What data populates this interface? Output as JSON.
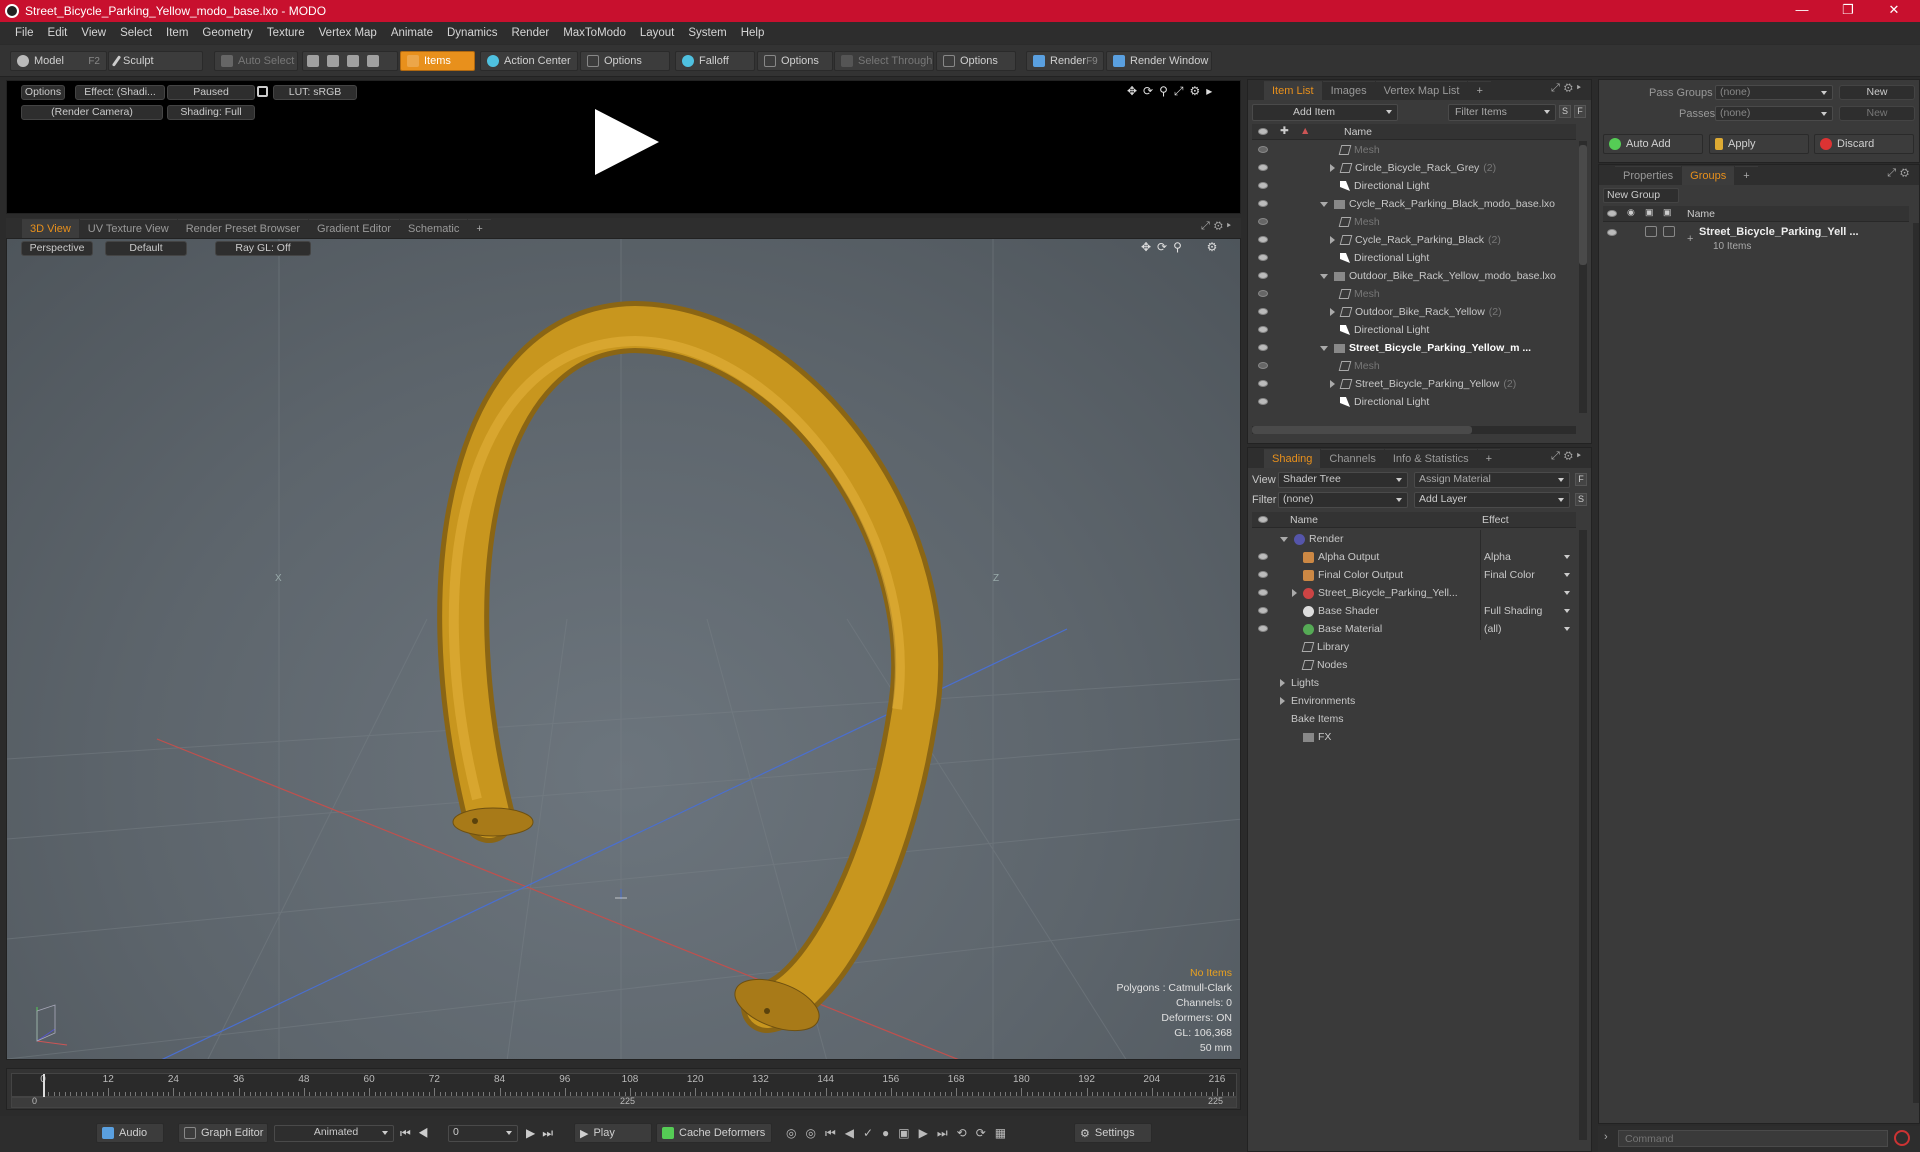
{
  "title": "Street_Bicycle_Parking_Yellow_modo_base.lxo - MODO",
  "menu": [
    "File",
    "Edit",
    "View",
    "Select",
    "Item",
    "Geometry",
    "Texture",
    "Vertex Map",
    "Animate",
    "Dynamics",
    "Render",
    "MaxToModo",
    "Layout",
    "System",
    "Help"
  ],
  "toolbar": {
    "model": "Model",
    "model_key": "F2",
    "sculpt": "Sculpt",
    "auto_select": "Auto Select",
    "items": "Items",
    "action_center": "Action Center",
    "options1": "Options",
    "falloff": "Falloff",
    "options2": "Options",
    "select_through": "Select Through",
    "options3": "Options",
    "render": "Render",
    "render_key": "F9",
    "render_window": "Render Window"
  },
  "preview": {
    "options": "Options",
    "effect": "Effect: (Shadi...",
    "paused": "Paused",
    "lut": "LUT: sRGB",
    "camera": "(Render Camera)",
    "shading": "Shading: Full"
  },
  "viewport_tabs": [
    "3D View",
    "UV Texture View",
    "Render Preset Browser",
    "Gradient Editor",
    "Schematic",
    "+"
  ],
  "viewport": {
    "perspective": "Perspective",
    "default": "Default",
    "raygl": "Ray GL: Off",
    "axis_x": "X",
    "axis_z": "Z"
  },
  "stats": {
    "items": "No Items",
    "polygons": "Polygons : Catmull-Clark",
    "channels": "Channels: 0",
    "deformers": "Deformers: ON",
    "gl": "GL: 106,368",
    "size": "50 mm"
  },
  "ruler": {
    "ticks": [
      "0",
      "12",
      "24",
      "36",
      "48",
      "60",
      "72",
      "84",
      "96",
      "108",
      "120",
      "132",
      "144",
      "156",
      "168",
      "180",
      "192",
      "204",
      "216"
    ],
    "start": "0",
    "mid": "225",
    "end": "225"
  },
  "bottom": {
    "audio": "Audio",
    "graph_editor": "Graph Editor",
    "animated": "Animated",
    "frame": "0",
    "play": "Play",
    "cache": "Cache Deformers",
    "settings": "Settings"
  },
  "itemlist": {
    "tabs": [
      "Item List",
      "Images",
      "Vertex Map List",
      "+"
    ],
    "add_item": "Add Item",
    "filter": "Filter Items",
    "s": "S",
    "f": "F",
    "col_name": "Name",
    "rows": [
      {
        "t": "mesh",
        "label": "Mesh",
        "indent": 2,
        "dim": true
      },
      {
        "t": "obj",
        "label": "Circle_Bicycle_Rack_Grey",
        "count": "(2)",
        "indent": 2
      },
      {
        "t": "light",
        "label": "Directional Light",
        "indent": 2
      },
      {
        "t": "scene",
        "label": "Cycle_Rack_Parking_Black_modo_base.lxo",
        "indent": 1
      },
      {
        "t": "mesh",
        "label": "Mesh",
        "indent": 2,
        "dim": true
      },
      {
        "t": "obj",
        "label": "Cycle_Rack_Parking_Black",
        "count": "(2)",
        "indent": 2
      },
      {
        "t": "light",
        "label": "Directional Light",
        "indent": 2
      },
      {
        "t": "scene",
        "label": "Outdoor_Bike_Rack_Yellow_modo_base.lxo",
        "indent": 1
      },
      {
        "t": "mesh",
        "label": "Mesh",
        "indent": 2,
        "dim": true
      },
      {
        "t": "obj",
        "label": "Outdoor_Bike_Rack_Yellow",
        "count": "(2)",
        "indent": 2
      },
      {
        "t": "light",
        "label": "Directional Light",
        "indent": 2
      },
      {
        "t": "scene",
        "label": "Street_Bicycle_Parking_Yellow_m ...",
        "indent": 1,
        "bold": true
      },
      {
        "t": "mesh",
        "label": "Mesh",
        "indent": 2,
        "dim": true
      },
      {
        "t": "obj",
        "label": "Street_Bicycle_Parking_Yellow",
        "count": "(2)",
        "indent": 2
      },
      {
        "t": "light",
        "label": "Directional Light",
        "indent": 2
      }
    ]
  },
  "shading": {
    "tabs": [
      "Shading",
      "Channels",
      "Info & Statistics",
      "+"
    ],
    "view_label": "View",
    "view_value": "Shader Tree",
    "assign": "Assign Material",
    "filter_label": "Filter",
    "filter_value": "(none)",
    "add_layer": "Add Layer",
    "col_name": "Name",
    "col_effect": "Effect",
    "rows": [
      {
        "label": "Render",
        "effect": "",
        "indent": 0,
        "eye": false,
        "icon": "render"
      },
      {
        "label": "Alpha Output",
        "effect": "Alpha",
        "indent": 1,
        "eye": true,
        "icon": "out"
      },
      {
        "label": "Final Color Output",
        "effect": "Final Color",
        "indent": 1,
        "eye": true,
        "icon": "out"
      },
      {
        "label": "Street_Bicycle_Parking_Yell...",
        "effect": "",
        "indent": 1,
        "eye": true,
        "icon": "mat"
      },
      {
        "label": "Base Shader",
        "effect": "Full Shading",
        "indent": 1,
        "eye": true,
        "icon": "shader"
      },
      {
        "label": "Base Material",
        "effect": "(all)",
        "indent": 1,
        "eye": true,
        "icon": "basemat"
      },
      {
        "label": "Library",
        "effect": "",
        "indent": 1,
        "eye": false,
        "icon": "folder"
      },
      {
        "label": "Nodes",
        "effect": "",
        "indent": 1,
        "eye": false,
        "icon": "folder"
      },
      {
        "label": "Lights",
        "effect": "",
        "indent": 0,
        "eye": false,
        "icon": "none"
      },
      {
        "label": "Environments",
        "effect": "",
        "indent": 0,
        "eye": false,
        "icon": "none"
      },
      {
        "label": "Bake Items",
        "effect": "",
        "indent": 0,
        "eye": false,
        "icon": "none"
      },
      {
        "label": "FX",
        "effect": "",
        "indent": 1,
        "eye": false,
        "icon": "fx"
      }
    ]
  },
  "passes": {
    "pass_groups": "Pass Groups",
    "pass_value": "(none)",
    "new1": "New",
    "passes": "Passes",
    "passes_value": "(none)",
    "new2": "New",
    "auto_add": "Auto Add",
    "apply": "Apply",
    "discard": "Discard"
  },
  "groups": {
    "tabs": [
      "Properties",
      "Groups",
      "+"
    ],
    "new_group": "New Group",
    "col_name": "Name",
    "group_name": "Street_Bicycle_Parking_Yell ...",
    "group_count": "10 Items"
  },
  "command": {
    "placeholder": "Command"
  }
}
